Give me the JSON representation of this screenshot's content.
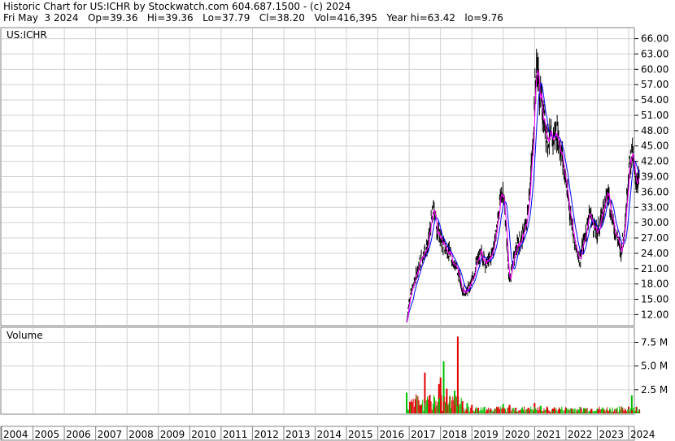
{
  "header": {
    "line1": "Historic Chart for US:ICHR by Stockwatch.com 604.687.1500 - (c) 2024",
    "line2": "Fri May  3 2024   Op=39.36   Hi=39.36   Lo=37.79   Cl=38.20   Vol=416,395   Year hi=63.42   lo=9.76"
  },
  "colors": {
    "price_bar": "#000000",
    "ma_short": "#ff00ff",
    "ma_long": "#0000ff",
    "volume_up": "#00c000",
    "volume_down": "#e00000",
    "grid": "#d0d0d0"
  },
  "chart_data": [
    {
      "type": "line",
      "title": "US:ICHR",
      "ylim": [
        10,
        68
      ],
      "y_ticks": [
        "66.00",
        "63.00",
        "60.00",
        "57.00",
        "54.00",
        "51.00",
        "48.00",
        "45.00",
        "42.00",
        "39.00",
        "36.00",
        "33.00",
        "30.00",
        "27.00",
        "24.00",
        "21.00",
        "18.00",
        "15.00",
        "12.00"
      ],
      "x_ticks": [
        "2004",
        "2005",
        "2006",
        "2007",
        "2008",
        "2009",
        "2010",
        "2011",
        "2012",
        "2013",
        "2014",
        "2015",
        "2016",
        "2017",
        "2018",
        "2019",
        "2020",
        "2021",
        "2022",
        "2023",
        "2024"
      ],
      "series": [
        {
          "values_t": [
            2016.92,
            2017.0,
            2017.15,
            2017.3,
            2017.45,
            2017.6,
            2017.7,
            2017.8,
            2017.9,
            2018.0,
            2018.1,
            2018.25,
            2018.4,
            2018.55,
            2018.7,
            2018.85,
            2019.0,
            2019.15,
            2019.3,
            2019.45,
            2019.6,
            2019.75,
            2019.9,
            2020.0,
            2020.1,
            2020.2,
            2020.3,
            2020.45,
            2020.6,
            2020.75,
            2020.85,
            2020.95,
            2021.0,
            2021.08,
            2021.15,
            2021.25,
            2021.4,
            2021.55,
            2021.7,
            2021.85,
            2022.0,
            2022.1,
            2022.2,
            2022.3,
            2022.45,
            2022.6,
            2022.75,
            2022.9,
            2023.0,
            2023.1,
            2023.2,
            2023.35,
            2023.5,
            2023.65,
            2023.75,
            2023.85,
            2023.92,
            2024.0,
            2024.1,
            2024.2,
            2024.34
          ],
          "values": [
            10.5,
            15.0,
            18.0,
            21.5,
            24.0,
            25.5,
            30.0,
            33.0,
            28.0,
            27.0,
            25.5,
            24.5,
            22.5,
            20.5,
            17.0,
            16.5,
            18.5,
            22.0,
            24.0,
            22.0,
            23.0,
            27.0,
            34.0,
            36.5,
            28.0,
            18.0,
            22.0,
            25.5,
            27.0,
            30.0,
            37.0,
            45.0,
            55.0,
            61.0,
            56.0,
            52.0,
            47.0,
            46.0,
            48.0,
            44.0,
            38.0,
            33.0,
            30.0,
            25.0,
            23.0,
            27.0,
            32.0,
            29.0,
            28.0,
            30.0,
            33.0,
            36.0,
            30.0,
            27.0,
            24.0,
            28.0,
            33.0,
            40.0,
            44.0,
            39.0,
            38.2
          ]
        }
      ],
      "last_close": 38.2
    },
    {
      "type": "bar",
      "title": "Volume",
      "ylim": [
        0,
        9000000
      ],
      "y_ticks": [
        "7.5 M",
        "5.0 M",
        "2.5 M"
      ],
      "series": [
        {
          "values_t": [
            2016.92,
            2017.05,
            2017.2,
            2017.35,
            2017.5,
            2017.65,
            2017.8,
            2017.95,
            2018.0,
            2018.1,
            2018.2,
            2018.3,
            2018.45,
            2018.55,
            2018.7,
            2018.85,
            2019.0,
            2019.2,
            2019.4,
            2019.6,
            2019.8,
            2020.0,
            2020.2,
            2020.4,
            2020.6,
            2020.8,
            2021.0,
            2021.2,
            2021.4,
            2021.6,
            2021.8,
            2022.0,
            2022.2,
            2022.4,
            2022.6,
            2022.8,
            2023.0,
            2023.2,
            2023.4,
            2023.6,
            2023.8,
            2024.0,
            2024.1,
            2024.25,
            2024.34
          ],
          "values": [
            2200000,
            1200000,
            1400000,
            900000,
            4300000,
            1900000,
            1700000,
            3100000,
            3800000,
            5500000,
            2600000,
            1800000,
            2400000,
            8100000,
            1300000,
            1100000,
            900000,
            600000,
            700000,
            500000,
            700000,
            1000000,
            900000,
            600000,
            500000,
            600000,
            1100000,
            800000,
            600000,
            500000,
            500000,
            600000,
            500000,
            400000,
            500000,
            400000,
            500000,
            400000,
            400000,
            500000,
            600000,
            700000,
            1900000,
            700000,
            416395
          ]
        }
      ]
    }
  ]
}
